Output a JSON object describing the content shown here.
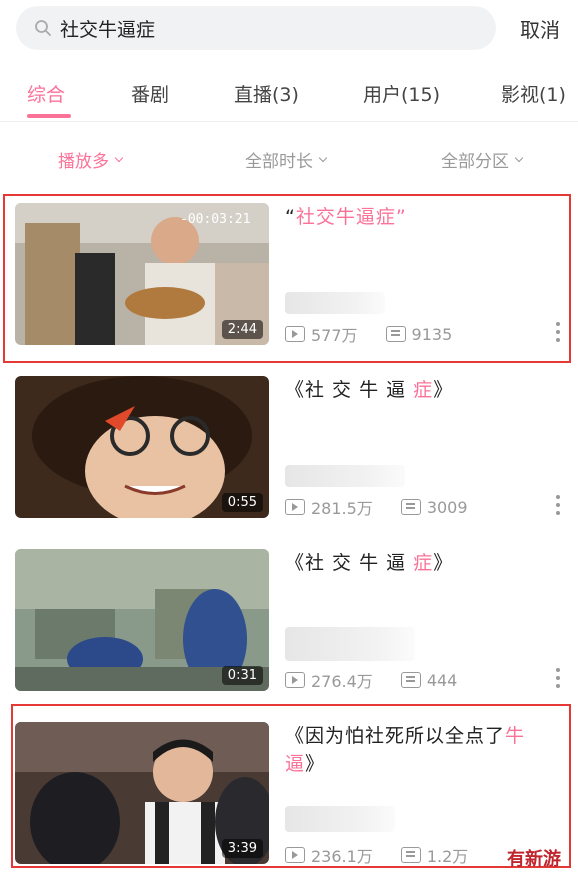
{
  "search": {
    "query": "社交牛逼症",
    "cancel_label": "取消"
  },
  "tabs": [
    {
      "label": "综合",
      "active": true
    },
    {
      "label": "番剧",
      "active": false
    },
    {
      "label": "直播(3)",
      "active": false
    },
    {
      "label": "用户(15)",
      "active": false
    },
    {
      "label": "影视(1)",
      "active": false
    }
  ],
  "filters": [
    {
      "label": "播放多",
      "active": true
    },
    {
      "label": "全部时长",
      "active": false
    },
    {
      "label": "全部分区",
      "active": false
    }
  ],
  "results": [
    {
      "title_plain": "“",
      "title_hl": "社交牛逼症”",
      "duration": "2:44",
      "views": "577万",
      "danmaku": "9135",
      "thumb_overlay": "-00:03:21",
      "highlighted": true
    },
    {
      "title_plain": "《社 交 牛 逼 ",
      "title_hl": "症",
      "title_tail": "》",
      "duration": "0:55",
      "views": "281.5万",
      "danmaku": "3009",
      "highlighted": false
    },
    {
      "title_plain": "《社 交 牛 逼 ",
      "title_hl": "症",
      "title_tail": "》",
      "duration": "0:31",
      "views": "276.4万",
      "danmaku": "444",
      "highlighted": false
    },
    {
      "title_plain": "《因为怕社死所以全点了",
      "title_hl": "牛逼",
      "title_tail": "》",
      "duration": "3:39",
      "views": "236.1万",
      "danmaku": "1.2万",
      "highlighted": true
    }
  ],
  "colors": {
    "accent": "#fb7299",
    "highlight_box": "#e53935"
  },
  "watermark": "有新游"
}
